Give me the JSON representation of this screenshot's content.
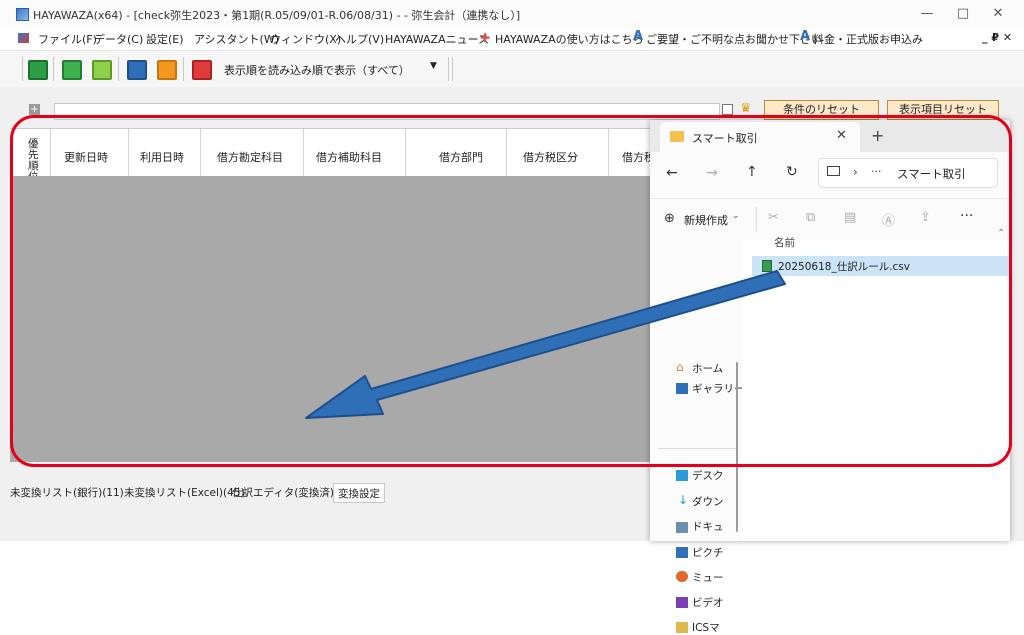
{
  "window": {
    "title": "HAYAWAZA(x64) - [check弥生2023・第1期(R.05/09/01-R.06/08/31) - - 弥生会計（連携なし）]",
    "minimize": "—",
    "maximize": "□",
    "close": "✕"
  },
  "menu": {
    "items": [
      "ファイル(F)",
      "データ(C)",
      "設定(E)",
      "アシスタント(W)",
      "ウィンドウ(X)",
      "ヘルプ(V)",
      "HAYAWAZAニュース"
    ],
    "links": [
      "HAYAWAZAの使い方はこちら",
      "ご要望・ご不明な点お聞かせ下さい",
      "料金・正式版お申込み"
    ],
    "child_controls": "_ ₽ ✕"
  },
  "toolbar": {
    "sort_label": "表示順を読み込み順で表示（すべて）"
  },
  "filter": {
    "reset_conditions": "条件のリセット",
    "reset_columns": "表示項目リセット"
  },
  "grid": {
    "columns": [
      "優先順位",
      "更新日時",
      "利用日時",
      "借方勘定科目",
      "借方補助科目",
      "借方部門",
      "借方税区分",
      "借方税"
    ]
  },
  "sheet_tabs": [
    "未変換リスト(銀行)(11)",
    "未変換リスト(Excel)(45)",
    "仕訳エディタ(変換済)(4)",
    "変換設定"
  ],
  "explorer": {
    "tab_title": "スマート取引",
    "address": "スマート取引",
    "new_label": "新規作成",
    "column_name": "名前",
    "file_name": "20250618_仕訳ルール.csv",
    "sidebar": [
      "ホーム",
      "ギャラリー",
      "デスク",
      "ダウン",
      "ドキュ",
      "ピクチ",
      "ミュー",
      "ビデオ",
      "ICSマ"
    ]
  },
  "colors": {
    "highlight": "#e4001a",
    "arrow": "#2f6fb8",
    "accent_button": "#fde9c8"
  }
}
